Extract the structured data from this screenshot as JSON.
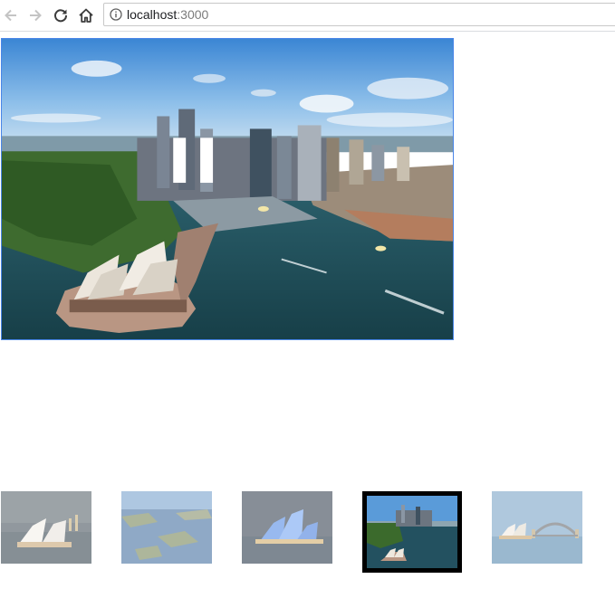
{
  "browser": {
    "url_host": "localhost",
    "url_port": ":3000",
    "icons": {
      "back": "arrow-left-icon",
      "forward": "arrow-right-icon",
      "reload": "reload-icon",
      "home": "home-icon",
      "site_info": "info-icon"
    }
  },
  "gallery": {
    "main_image": "sydney-harbour-aerial",
    "thumbnails": [
      {
        "image": "sydney-opera-house-night",
        "selected": false
      },
      {
        "image": "sydney-harbour-islands",
        "selected": false
      },
      {
        "image": "opera-house-blue-lights",
        "selected": false
      },
      {
        "image": "sydney-harbour-aerial",
        "selected": true
      },
      {
        "image": "opera-house-harbour-bridge",
        "selected": false
      }
    ],
    "colors": {
      "main_border": "#4a86e8",
      "selected_border": "#000000"
    }
  }
}
